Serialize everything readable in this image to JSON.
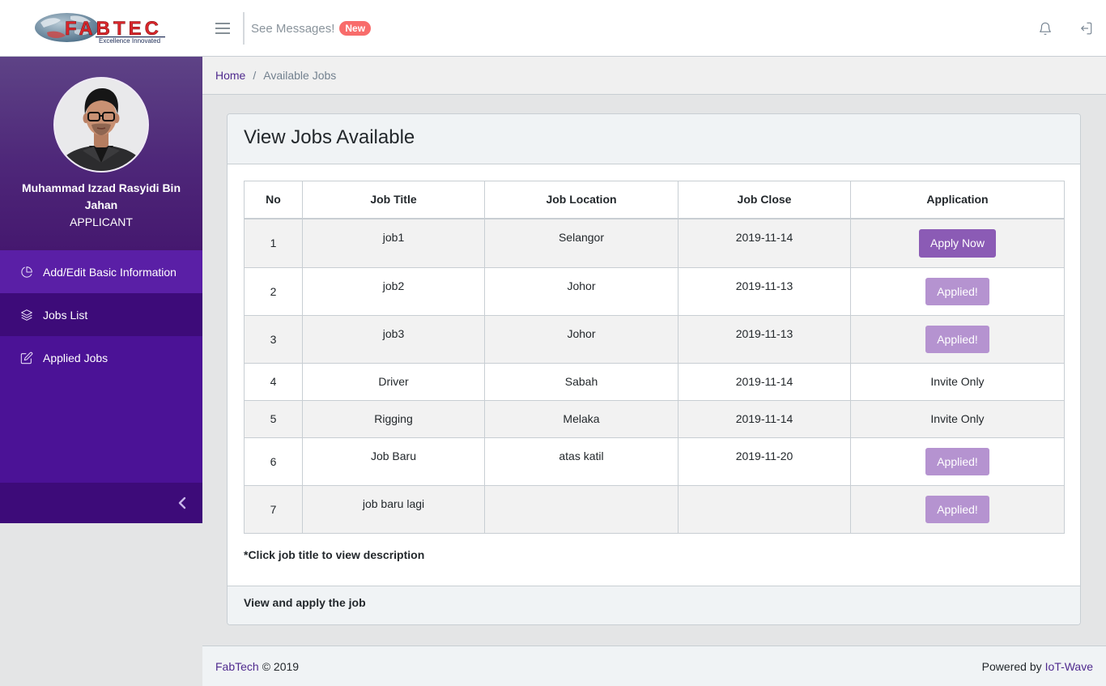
{
  "header": {
    "logo": {
      "text": "FABTEC",
      "tagline": "Excellence Innovated"
    },
    "menu_icon": "hamburger-icon",
    "messages": {
      "label": "See Messages!",
      "badge": "New"
    },
    "notifications_icon": "bell-icon",
    "logout_icon": "logout-icon"
  },
  "sidebar": {
    "user": {
      "name": "Muhammad Izzad Rasyidi Bin Jahan",
      "role": "APPLICANT"
    },
    "items": [
      {
        "label": "Add/Edit Basic Information",
        "icon": "pie-chart-icon",
        "active": false
      },
      {
        "label": "Jobs List",
        "icon": "layers-icon",
        "active": true
      },
      {
        "label": "Applied Jobs",
        "icon": "note-icon",
        "active": false
      }
    ],
    "minimizer_icon": "chevron-left-icon"
  },
  "breadcrumb": {
    "home": "Home",
    "separator": "/",
    "current": "Available Jobs"
  },
  "card": {
    "title": "View Jobs Available",
    "table": {
      "columns": [
        "No",
        "Job Title",
        "Job Location",
        "Job Close",
        "Application"
      ],
      "rows": [
        {
          "no": "1",
          "title": "job1",
          "location": "Selangor",
          "close": "2019-11-14",
          "application": {
            "kind": "button",
            "label": "Apply Now",
            "enabled": true
          }
        },
        {
          "no": "2",
          "title": "job2",
          "location": "Johor",
          "close": "2019-11-13",
          "application": {
            "kind": "button",
            "label": "Applied!",
            "enabled": false
          }
        },
        {
          "no": "3",
          "title": "job3",
          "location": "Johor",
          "close": "2019-11-13",
          "application": {
            "kind": "button",
            "label": "Applied!",
            "enabled": false
          }
        },
        {
          "no": "4",
          "title": "Driver",
          "location": "Sabah",
          "close": "2019-11-14",
          "application": {
            "kind": "text",
            "label": "Invite Only"
          }
        },
        {
          "no": "5",
          "title": "Rigging",
          "location": "Melaka",
          "close": "2019-11-14",
          "application": {
            "kind": "text",
            "label": "Invite Only"
          }
        },
        {
          "no": "6",
          "title": "Job Baru",
          "location": "atas katil",
          "close": "2019-11-20",
          "application": {
            "kind": "button",
            "label": "Applied!",
            "enabled": false
          }
        },
        {
          "no": "7",
          "title": "job baru lagi",
          "location": "",
          "close": "",
          "application": {
            "kind": "button",
            "label": "Applied!",
            "enabled": false
          }
        }
      ]
    },
    "note": "*Click job title to view description",
    "footer": "View and apply the job"
  },
  "footer": {
    "brand": "FabTech",
    "copyright": "© 2019",
    "powered_by": "Powered by",
    "powered_link": "IoT-Wave"
  },
  "colors": {
    "sidebar": "#4b1296",
    "sidebar_active": "#3d0b79",
    "primary_button": "#8b5bb5",
    "badge": "#f86c6b",
    "link": "#4f2a8e"
  }
}
